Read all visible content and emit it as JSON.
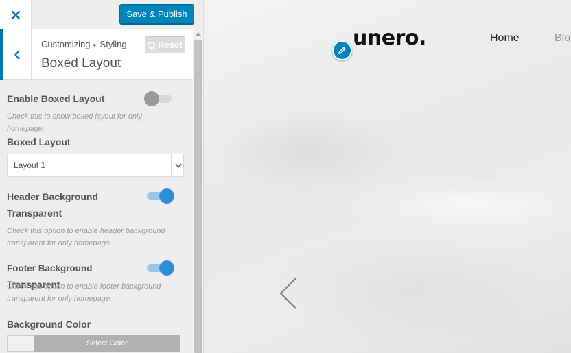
{
  "topbar": {
    "close_icon": "close-icon",
    "publish_label": "Save & Publish",
    "accent_color": "#0085ba"
  },
  "section": {
    "breadcrumb_parent": "Customizing",
    "breadcrumb_child": "Styling",
    "title": "Boxed Layout",
    "reset_label": "Reset",
    "back_icon": "chevron-left-icon",
    "reset_icon": "undo-icon"
  },
  "controls": {
    "boxed_enable": {
      "title": "Enable Boxed Layout",
      "description": "Check this to show boxed layout for only homepage.",
      "checked": false
    },
    "boxed_layout": {
      "title": "Boxed Layout",
      "selected": "Layout 1"
    },
    "header_transparent": {
      "title": "Header Background Transparent",
      "description": "Check this option to enable header background transparent for only homepage.",
      "checked": true
    },
    "footer_transparent": {
      "title": "Footer Background Transparent",
      "description": "Check this option to enable footer background transparent for only homepage.",
      "checked": true
    },
    "background_color": {
      "title": "Background Color",
      "button_label": "Select Color"
    }
  },
  "preview": {
    "logo": "unero.",
    "nav": [
      "Home",
      "Blo"
    ],
    "edit_icon": "pencil-icon",
    "prev_icon": "chevron-left-icon"
  }
}
